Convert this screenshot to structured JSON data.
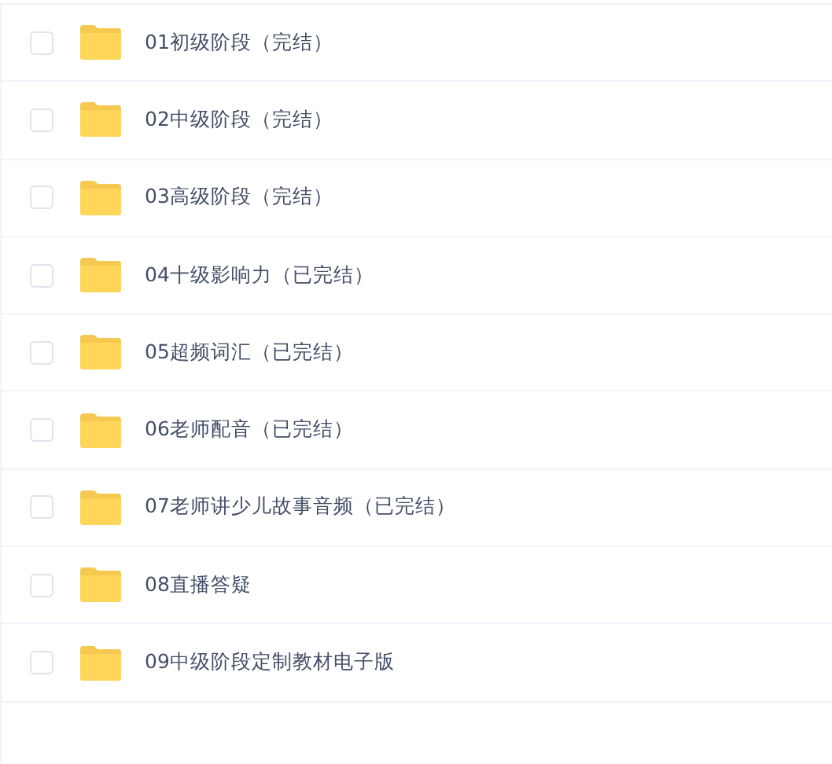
{
  "files": [
    {
      "name": "01初级阶段（完结）",
      "checked": false
    },
    {
      "name": "02中级阶段（完结）",
      "checked": false
    },
    {
      "name": "03高级阶段（完结）",
      "checked": false
    },
    {
      "name": "04十级影响力（已完结）",
      "checked": false
    },
    {
      "name": "05超频词汇（已完结）",
      "checked": false
    },
    {
      "name": "06老师配音（已完结）",
      "checked": false
    },
    {
      "name": "07老师讲少儿故事音频（已完结）",
      "checked": false
    },
    {
      "name": "08直播答疑",
      "checked": false
    },
    {
      "name": "09中级阶段定制教材电子版",
      "checked": false
    }
  ]
}
